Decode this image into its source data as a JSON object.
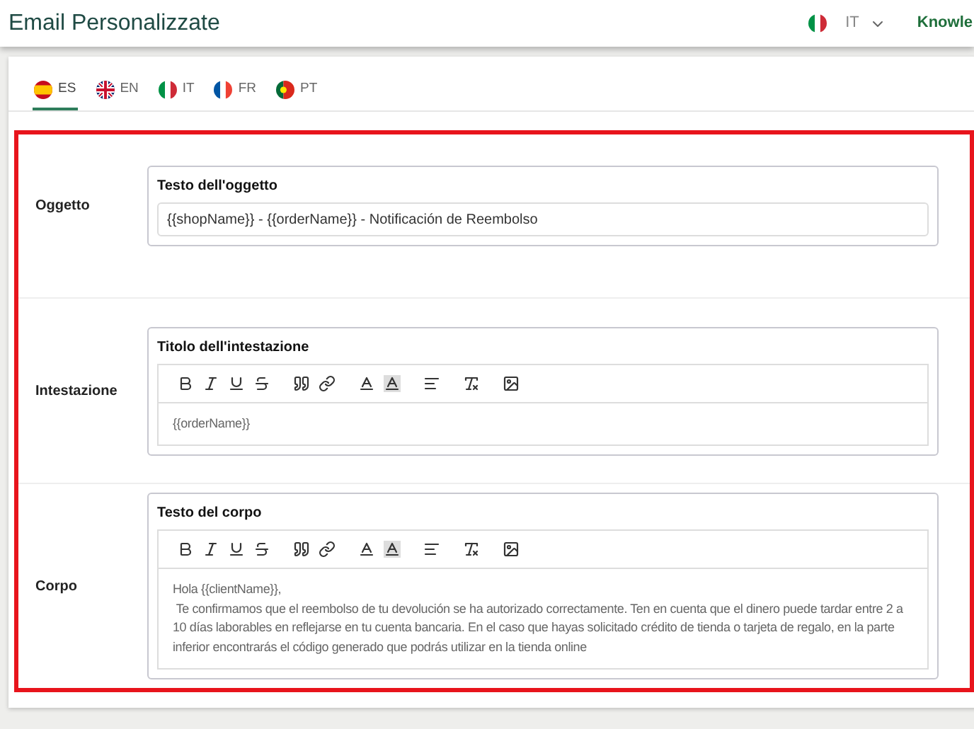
{
  "header": {
    "title": "Email Personalizzate",
    "language": {
      "kind": "it",
      "code": "IT"
    },
    "link": "Knowle"
  },
  "tabs": [
    {
      "kind": "es",
      "label": "ES",
      "selected": true
    },
    {
      "kind": "en",
      "label": "EN",
      "selected": false
    },
    {
      "kind": "it",
      "label": "IT",
      "selected": false
    },
    {
      "kind": "fr",
      "label": "FR",
      "selected": false
    },
    {
      "kind": "pt",
      "label": "PT",
      "selected": false
    }
  ],
  "sections": [
    {
      "kind": "input",
      "label": "Oggetto",
      "field_label": "Testo dell'oggetto",
      "value": "{{shopName}} - {{orderName}} - Notificación de Reembolso"
    },
    {
      "kind": "editor",
      "label": "Intestazione",
      "field_label": "Titolo dell'intestazione",
      "lines": [
        "{{orderName}}"
      ]
    },
    {
      "kind": "editor",
      "label": "Corpo",
      "field_label": "Testo del corpo",
      "lines": [
        "Hola {{clientName}},",
        " Te confirmamos que el reembolso de tu devolución se ha autorizado correctamente. Ten en cuenta que el dinero puede tardar entre 2 a 10 días laborables en reflejarse en tu cuenta bancaria. En el caso que hayas solicitado crédito de tienda o tarjeta de regalo, en la parte inferior encontrarás el código generado que podrás utilizar en la tienda online"
      ]
    }
  ]
}
